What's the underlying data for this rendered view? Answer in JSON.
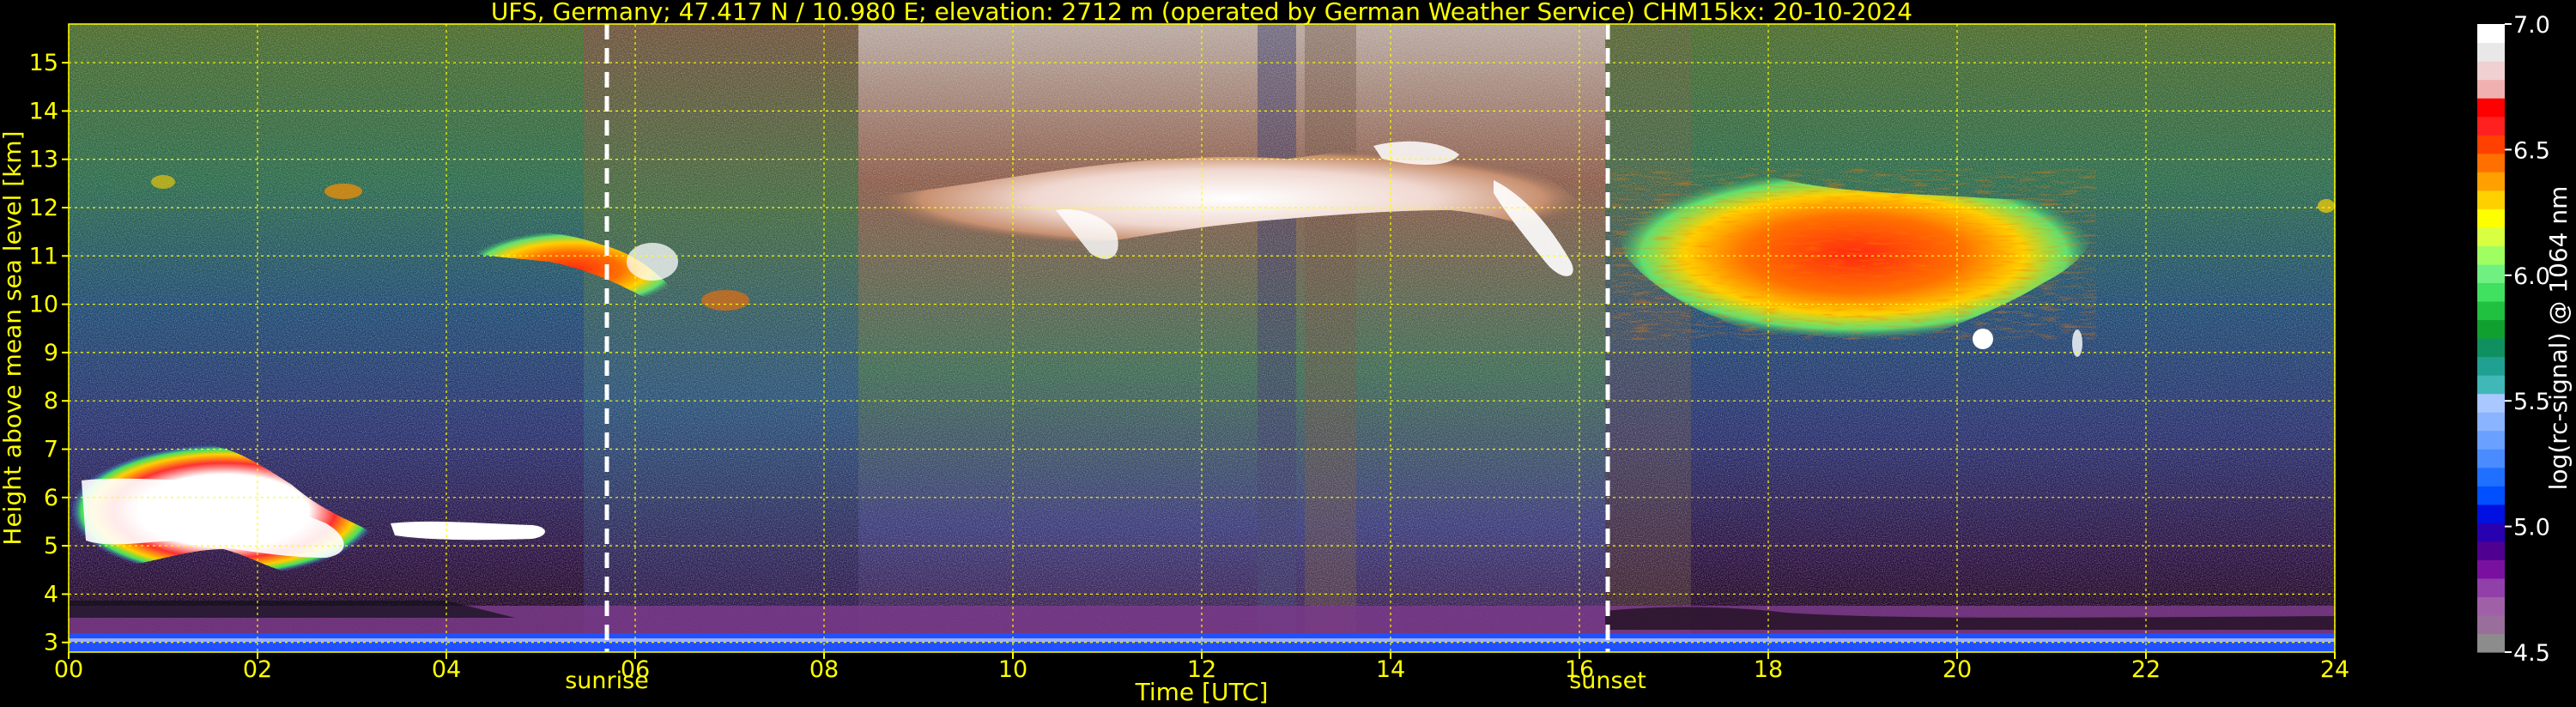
{
  "chart_data": {
    "type": "heatmap",
    "title": "UFS, Germany; 47.417 N / 10.980 E; elevation: 2712 m  (operated by German Weather Service)    CHM15kx: 20-10-2024",
    "xlabel": "Time [UTC]",
    "ylabel": "Height above mean sea level [km]",
    "xlim": [
      0,
      24
    ],
    "ylim": [
      2.8,
      15.8
    ],
    "x_ticks": [
      0,
      2,
      4,
      6,
      8,
      10,
      12,
      14,
      16,
      18,
      20,
      22,
      24
    ],
    "x_tick_labels": [
      "00",
      "02",
      "04",
      "06",
      "08",
      "10",
      "12",
      "14",
      "16",
      "18",
      "20",
      "22",
      "24"
    ],
    "y_ticks": [
      3,
      4,
      5,
      6,
      7,
      8,
      9,
      10,
      11,
      12,
      13,
      14,
      15
    ],
    "y_tick_labels": [
      "3",
      "4",
      "5",
      "6",
      "7",
      "8",
      "9",
      "10",
      "11",
      "12",
      "13",
      "14",
      "15"
    ],
    "grid": true,
    "grid_color": "#ffff00",
    "events": [
      {
        "name": "sunrise",
        "time": 5.7
      },
      {
        "name": "sunset",
        "time": 16.3
      }
    ],
    "colorbar": {
      "label": "log(rc-signal) @ 1064 nm",
      "range": [
        4.5,
        7.0
      ],
      "ticks": [
        4.5,
        5.0,
        5.5,
        6.0,
        6.5,
        7.0
      ],
      "tick_labels": [
        "4.5",
        "5.0",
        "5.5",
        "6.0",
        "6.5",
        "7.0"
      ],
      "colors": [
        "#8c8c8c",
        "#9a6e9a",
        "#a060a8",
        "#9040a8",
        "#7a10a0",
        "#500090",
        "#2800b0",
        "#0010e0",
        "#0050ff",
        "#2070ff",
        "#4a8cff",
        "#6aa0ff",
        "#8ab4ff",
        "#a8c8ff",
        "#40b8b8",
        "#20a090",
        "#109060",
        "#10a030",
        "#20c040",
        "#40e060",
        "#70f080",
        "#a0ff60",
        "#d8ff40",
        "#ffff00",
        "#ffd000",
        "#ffa000",
        "#ff7000",
        "#ff4000",
        "#ff2020",
        "#ff0000",
        "#f0b0b0",
        "#f0d0d0",
        "#e8e8e8",
        "#ffffff"
      ]
    },
    "features": [
      {
        "name": "low cloud",
        "t_start": 0.0,
        "t_end": 3.2,
        "h_bottom": 4.3,
        "h_top": 7.0,
        "level": "7.0"
      },
      {
        "name": "thin layer",
        "t_start": 3.3,
        "t_end": 4.9,
        "h_bottom": 5.1,
        "h_top": 5.4,
        "level": "7.0"
      },
      {
        "name": "cirrus",
        "t_start": 4.2,
        "t_end": 7.1,
        "h_bottom": 9.9,
        "h_top": 11.5,
        "level": "6.5"
      },
      {
        "name": "cirrus",
        "t_start": 8.3,
        "t_end": 16.0,
        "h_bottom": 10.4,
        "h_top": 13.2,
        "level": "7.0"
      },
      {
        "name": "cirrus",
        "t_start": 16.4,
        "t_end": 21.4,
        "h_bottom": 9.0,
        "h_top": 12.4,
        "level": "6.4"
      },
      {
        "name": "surface signal",
        "t_start": 0.0,
        "t_end": 24.0,
        "h_bottom": 2.8,
        "h_top": 3.5,
        "level": "5.0"
      }
    ]
  }
}
